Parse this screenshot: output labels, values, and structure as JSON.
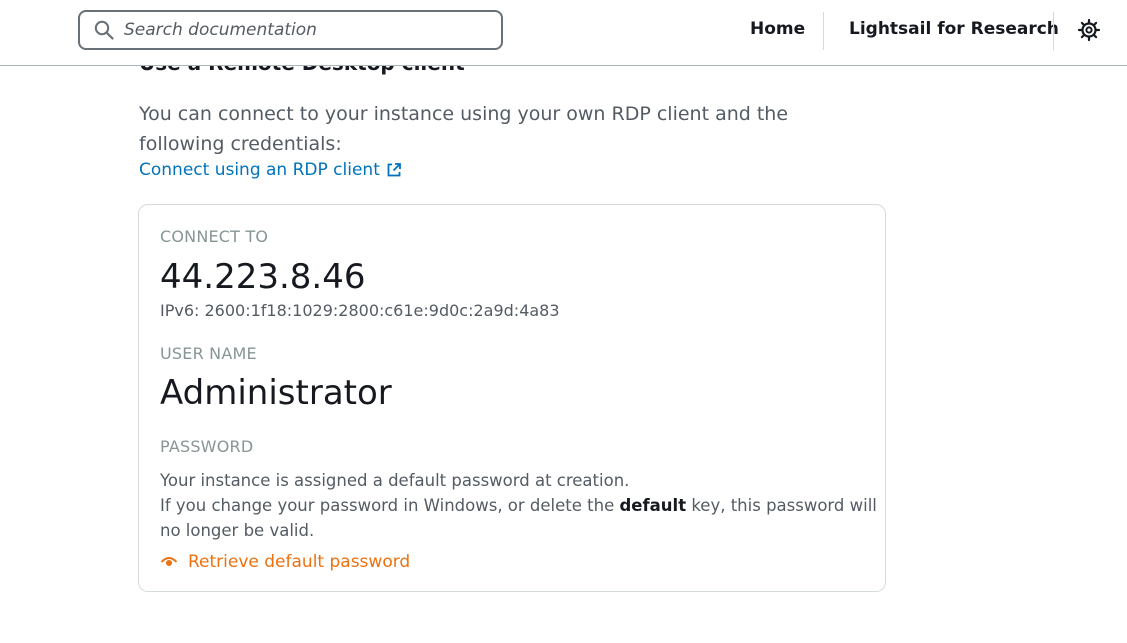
{
  "header": {
    "search_placeholder": "Search documentation",
    "nav_home": "Home",
    "nav_lightsail": "Lightsail for Research",
    "settings_icon": "gear-icon"
  },
  "section": {
    "heading": "Use a Remote Desktop client",
    "intro": "You can connect to your instance using your own RDP client and the following credentials:",
    "rdp_link": "Connect using an RDP client",
    "rdp_link_icon": "external-link-icon"
  },
  "card": {
    "connect_label": "CONNECT TO",
    "ip": "44.223.8.46",
    "ipv6": "IPv6: 2600:1f18:1029:2800:c61e:9d0c:2a9d:4a83",
    "username_label": "USER NAME",
    "username": "Administrator",
    "password_label": "PASSWORD",
    "password_line1": "Your instance is assigned a default password at creation.",
    "password_line2_pre": "If you change your password in Windows, or delete the ",
    "password_line2_bold": "default",
    "password_line2_post": " key, this password will no longer be valid.",
    "retrieve_label": "Retrieve default password",
    "retrieve_icon": "eye-icon"
  },
  "colors": {
    "link_blue": "#0073bb",
    "accent_orange": "#ec7211",
    "text_dark": "#16191f",
    "text_muted": "#545b64",
    "label_gray": "#879596",
    "border": "#d5dbdb"
  }
}
